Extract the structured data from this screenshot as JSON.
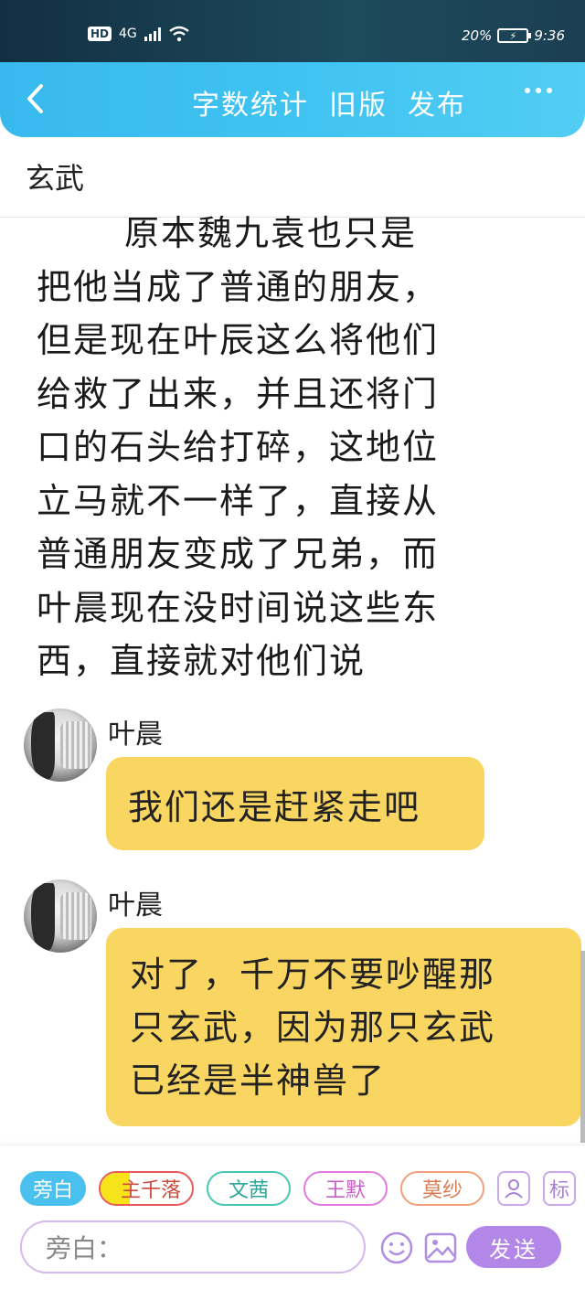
{
  "status_bar": {
    "hd": "HD",
    "network": "4G",
    "battery_percent": "20%",
    "time": "9:36"
  },
  "header": {
    "actions": [
      "字数统计",
      "旧版",
      "发布"
    ],
    "back_icon": "chevron-left-icon",
    "more_icon": "more-dots-icon"
  },
  "page": {
    "title": "玄武"
  },
  "narration": {
    "lines": [
      "原本魏九袁也只是",
      "把他当成了普通的朋友，",
      "但是现在叶辰这么将他们",
      "给救了出来，并且还将门",
      "口的石头给打碎，这地位",
      "立马就不一样了，直接从",
      "普通朋友变成了兄弟，而",
      "叶晨现在没时间说这些东",
      "西，直接就对他们说"
    ]
  },
  "messages": [
    {
      "speaker": "叶晨",
      "lines": [
        "我们还是赶紧走吧"
      ]
    },
    {
      "speaker": "叶晨",
      "lines": [
        "对了，千万不要吵醒那",
        "只玄武，因为那只玄武",
        "已经是半神兽了"
      ]
    }
  ],
  "bottom_bar": {
    "roles": [
      {
        "label": "旁白",
        "active": true
      },
      {
        "prefix": "主",
        "label": "千落"
      },
      {
        "label": "文茜"
      },
      {
        "label": "王默"
      },
      {
        "label": "莫纱"
      }
    ],
    "tag_button": "标",
    "input_placeholder": "旁白：",
    "send_label": "发送"
  },
  "colors": {
    "header_accent": "#3fc3f1",
    "bubble": "#f9d561",
    "send_button": "#b287e8"
  }
}
